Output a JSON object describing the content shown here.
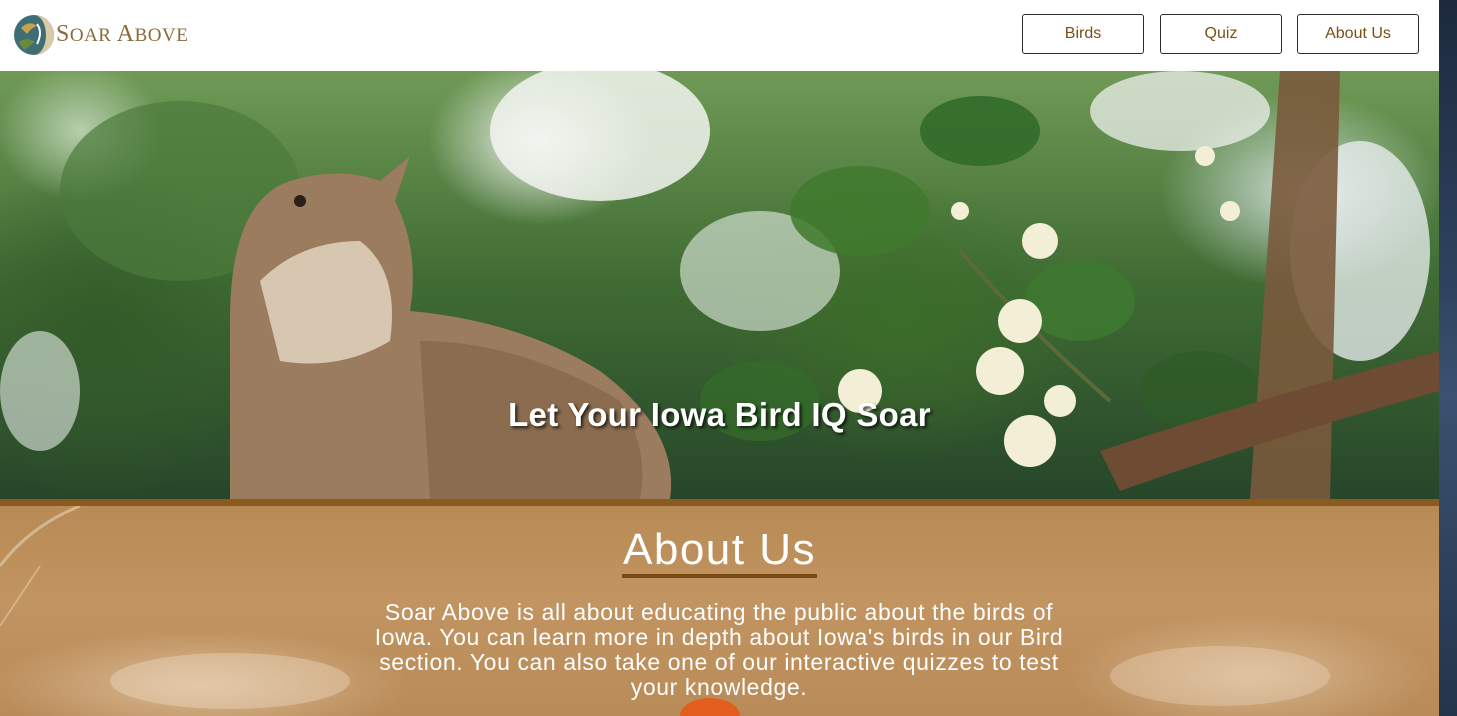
{
  "header": {
    "logo": {
      "icon": "bird-logo-icon",
      "text_first": "S",
      "text_rest": "OAR ",
      "text_second": "A",
      "text_second_rest": "BOVE"
    },
    "nav": [
      {
        "label": "Birds"
      },
      {
        "label": "Quiz"
      },
      {
        "label": "About Us"
      }
    ]
  },
  "hero": {
    "title": "Let Your Iowa Bird IQ Soar"
  },
  "about": {
    "title": "About Us",
    "body": "Soar Above is all about educating the public about the birds of Iowa. You can learn more in depth about Iowa's birds in our Bird section. You can also take one of our interactive quizzes to test your knowledge."
  },
  "colors": {
    "accent_brown": "#7a4f16",
    "divider": "#8b5a1e",
    "about_bg": "#c29461",
    "logo_text": "#8a6a3a"
  }
}
